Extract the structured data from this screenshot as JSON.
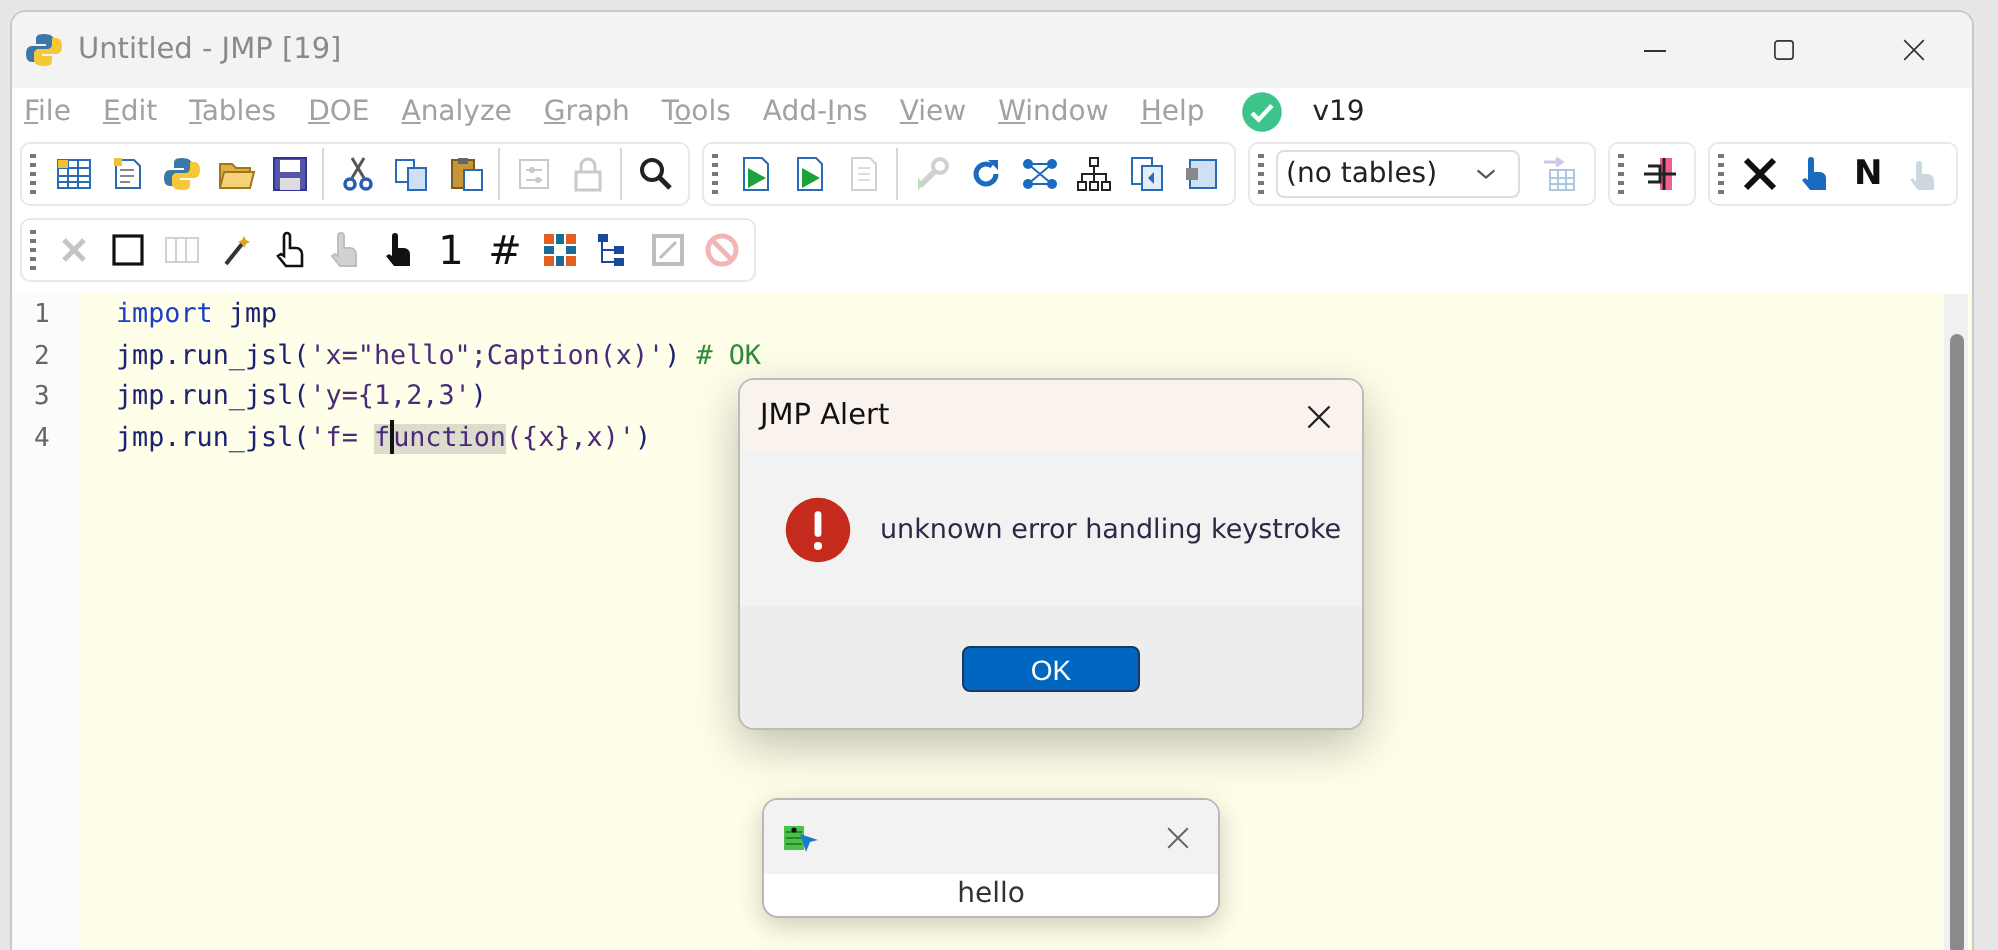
{
  "window": {
    "title": "Untitled - JMP [19]"
  },
  "menu": {
    "items": [
      {
        "access_key": "F",
        "rest": "ile"
      },
      {
        "access_key": "E",
        "rest": "dit"
      },
      {
        "access_key": "T",
        "rest": "ables"
      },
      {
        "access_key": "D",
        "rest": "OE"
      },
      {
        "access_key": "A",
        "rest": "nalyze"
      },
      {
        "access_key": "G",
        "rest": "raph"
      },
      {
        "lead": "T",
        "access_key": "o",
        "rest": "ols"
      },
      {
        "lead": "Add-",
        "access_key": "I",
        "rest": "ns"
      },
      {
        "access_key": "V",
        "rest": "iew"
      },
      {
        "access_key": "W",
        "rest": "indow"
      },
      {
        "access_key": "H",
        "rest": "elp"
      }
    ],
    "version": "v19"
  },
  "toolbars": [
    [
      [
        {
          "kind": "button",
          "disabled": false
        },
        {
          "kind": "button",
          "disabled": false
        },
        {
          "kind": "button",
          "disabled": false
        },
        {
          "kind": "button",
          "disabled": false
        },
        {
          "kind": "button",
          "disabled": false
        },
        {
          "kind": "separator"
        },
        {
          "kind": "button",
          "disabled": false
        },
        {
          "kind": "button",
          "disabled": false
        },
        {
          "kind": "button",
          "disabled": false
        },
        {
          "kind": "separator"
        },
        {
          "kind": "button",
          "disabled": true
        },
        {
          "kind": "button",
          "disabled": true
        },
        {
          "kind": "separator"
        },
        {
          "kind": "button",
          "disabled": false
        }
      ],
      [
        {
          "kind": "button",
          "disabled": false
        },
        {
          "kind": "button",
          "disabled": false
        },
        {
          "kind": "button",
          "disabled": true
        },
        {
          "kind": "separator"
        },
        {
          "kind": "button",
          "disabled": true
        },
        {
          "kind": "button",
          "disabled": false
        },
        {
          "kind": "button",
          "disabled": false
        },
        {
          "kind": "button",
          "disabled": false
        },
        {
          "kind": "button",
          "disabled": false
        },
        {
          "kind": "button",
          "disabled": false
        }
      ],
      [
        {
          "kind": "dropdown",
          "value": "(no tables)"
        },
        {
          "kind": "button",
          "disabled": true
        }
      ],
      [
        {
          "kind": "button",
          "disabled": false
        }
      ],
      [
        {
          "kind": "button",
          "disabled": false
        },
        {
          "kind": "button",
          "disabled": false
        },
        {
          "kind": "button",
          "disabled": false,
          "glyph": "N"
        },
        {
          "kind": "button",
          "disabled": true
        }
      ]
    ],
    [
      [
        {
          "kind": "button",
          "disabled": true
        },
        {
          "kind": "button",
          "disabled": false
        },
        {
          "kind": "button",
          "disabled": true
        },
        {
          "kind": "button",
          "disabled": false
        },
        {
          "kind": "button",
          "disabled": false
        },
        {
          "kind": "button",
          "disabled": true
        },
        {
          "kind": "button",
          "disabled": false
        },
        {
          "kind": "button",
          "disabled": false,
          "glyph": "1"
        },
        {
          "kind": "button",
          "disabled": false,
          "glyph": "#"
        },
        {
          "kind": "button",
          "disabled": false
        },
        {
          "kind": "button",
          "disabled": false
        },
        {
          "kind": "button",
          "disabled": true
        },
        {
          "kind": "button",
          "disabled": true
        }
      ]
    ]
  ],
  "editor": {
    "lines": [
      {
        "number": "1",
        "tokens": [
          {
            "kind": "keyword",
            "text": "import"
          },
          {
            "kind": "plain",
            "text": " jmp"
          }
        ]
      },
      {
        "number": "2",
        "tokens": [
          {
            "kind": "plain",
            "text": "jmp.run_jsl("
          },
          {
            "kind": "string",
            "text": "'x=\"hello\";Caption(x)'"
          },
          {
            "kind": "plain",
            "text": ") "
          },
          {
            "kind": "comment",
            "text": "# OK"
          }
        ]
      },
      {
        "number": "3",
        "tokens": [
          {
            "kind": "plain",
            "text": "jmp.run_jsl("
          },
          {
            "kind": "string",
            "text": "'y={1,2,3'"
          },
          {
            "kind": "plain",
            "text": ")"
          }
        ]
      },
      {
        "number": "4",
        "tokens": [
          {
            "kind": "plain",
            "text": "jmp.run_jsl("
          },
          {
            "kind": "string",
            "text": "'f= "
          },
          {
            "kind": "match",
            "text": "f"
          },
          {
            "kind": "match",
            "text": "unction",
            "caret_before": true
          },
          {
            "kind": "string",
            "text": "({x},x)'"
          },
          {
            "kind": "plain",
            "text": ")"
          }
        ]
      }
    ]
  },
  "alert": {
    "title": "JMP Alert",
    "message": "unknown error handling keystroke",
    "button": "OK"
  },
  "caption": {
    "text": "hello"
  }
}
